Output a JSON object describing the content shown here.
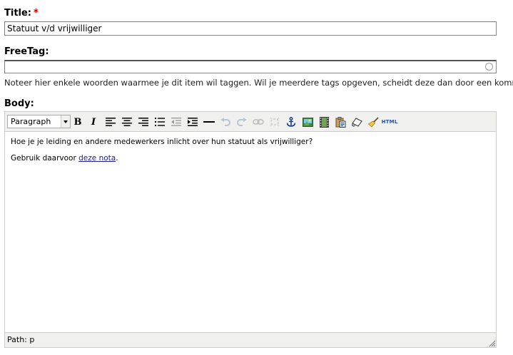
{
  "title_field": {
    "label": "Title:",
    "required_mark": "*",
    "value": "Statuut v/d vrijwilliger"
  },
  "freetag_field": {
    "label": "FreeTag:",
    "value": "",
    "description": "Noteer hier enkele woorden waarmee je dit item wil taggen. Wil je meerdere tags opgeven, scheidt deze dan door een komma."
  },
  "body_field": {
    "label": "Body:",
    "toolbar": {
      "format_value": "Paragraph",
      "html_label": "HTML"
    },
    "content": {
      "line1": "Hoe je je leiding en andere medewerkers inlicht over hun statuut als vrijwilliger?",
      "line2_prefix": "Gebruik daarvoor ",
      "line2_link": "deze nota",
      "line2_suffix": "."
    },
    "statusbar": {
      "path": "Path: p"
    }
  }
}
